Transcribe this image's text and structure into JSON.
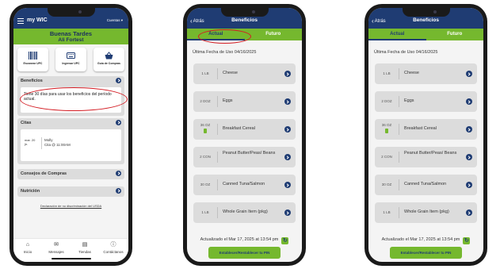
{
  "phone1": {
    "topbar": {
      "title": "my WIC",
      "account": "Cuentas"
    },
    "greeting": {
      "line1": "Buenas Tardes",
      "line2": "Ali Fortest"
    },
    "quick_actions": [
      {
        "label": "Escanear UPC",
        "icon": "barcode-icon"
      },
      {
        "label": "Ingresar UPC",
        "icon": "keyboard-icon"
      },
      {
        "label": "Guía de Compras",
        "icon": "basket-icon"
      }
    ],
    "benefits": {
      "title": "Beneficios",
      "message": "Tiene 30 días para usar los beneficios del período actual."
    },
    "appointments": {
      "title": "Citas",
      "item": {
        "date_line1": "mar. 20",
        "date_line2": "jn.",
        "name": "Molly",
        "detail": "Cita @ 11:00AM"
      }
    },
    "shopping_tips": {
      "title": "Consejos de Compras"
    },
    "nutrition": {
      "title": "Nutrición"
    },
    "usda_link": "Declaración de no discriminación del USDA",
    "bottom_nav": [
      {
        "label": "Inicio",
        "icon": "home-icon"
      },
      {
        "label": "Mensajes",
        "icon": "mail-icon"
      },
      {
        "label": "Tiendas",
        "icon": "store-icon"
      },
      {
        "label": "Contáctanos",
        "icon": "help-icon"
      }
    ]
  },
  "benefits_screen": {
    "back_label": "Atrás",
    "title": "Beneficios",
    "tabs": {
      "current": "Actual",
      "future": "Futuro"
    },
    "last_use_label": "Última Fecha de Uso 04/16/2025",
    "items": [
      {
        "qty": "1 LB",
        "name": "Cheese"
      },
      {
        "qty": "2 DOZ",
        "name": "Eggs"
      },
      {
        "qty": "36 OZ",
        "name": "Breakfast Cereal"
      },
      {
        "qty": "2 CON",
        "name": "Peanut Butter/Peas/ Beans"
      },
      {
        "qty": "30 OZ",
        "name": "Canned Tuna/Salmon"
      },
      {
        "qty": "1 LB",
        "name": "Whole Grain Item (pkg)"
      }
    ],
    "updated_label": "Actualizado el Mar 17, 2025 at 13:54 pm",
    "pin_button": "Establecer/Restablecer tu PIN"
  },
  "colors": {
    "navy": "#1f3c73",
    "green": "#75b82e",
    "highlight_red": "#d41d24",
    "card_gray": "#dcdcdc"
  }
}
